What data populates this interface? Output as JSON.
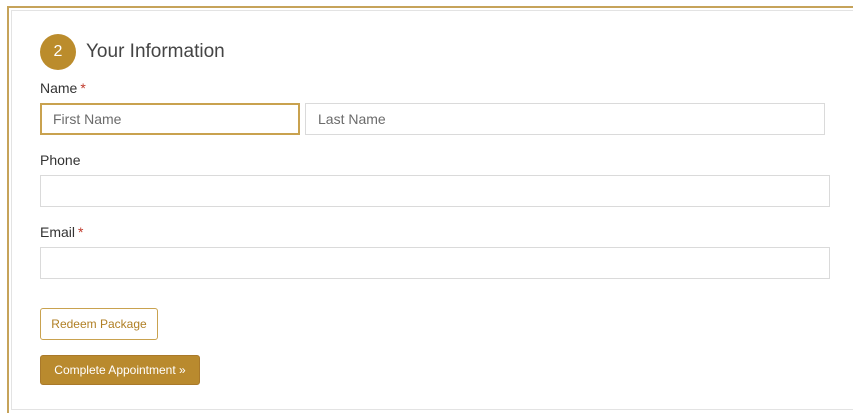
{
  "section": {
    "step_number": "2",
    "title": "Your Information"
  },
  "form": {
    "name": {
      "label": "Name",
      "required_mark": "*",
      "first_placeholder": "First Name",
      "first_value": "",
      "last_placeholder": "Last Name",
      "last_value": ""
    },
    "phone": {
      "label": "Phone",
      "value": ""
    },
    "email": {
      "label": "Email",
      "required_mark": "*",
      "value": ""
    }
  },
  "buttons": {
    "redeem_label": "Redeem Package",
    "complete_label": "Complete Appointment »"
  },
  "colors": {
    "accent": "#bb8c2c",
    "required": "#c0392b",
    "border": "#dadada"
  }
}
